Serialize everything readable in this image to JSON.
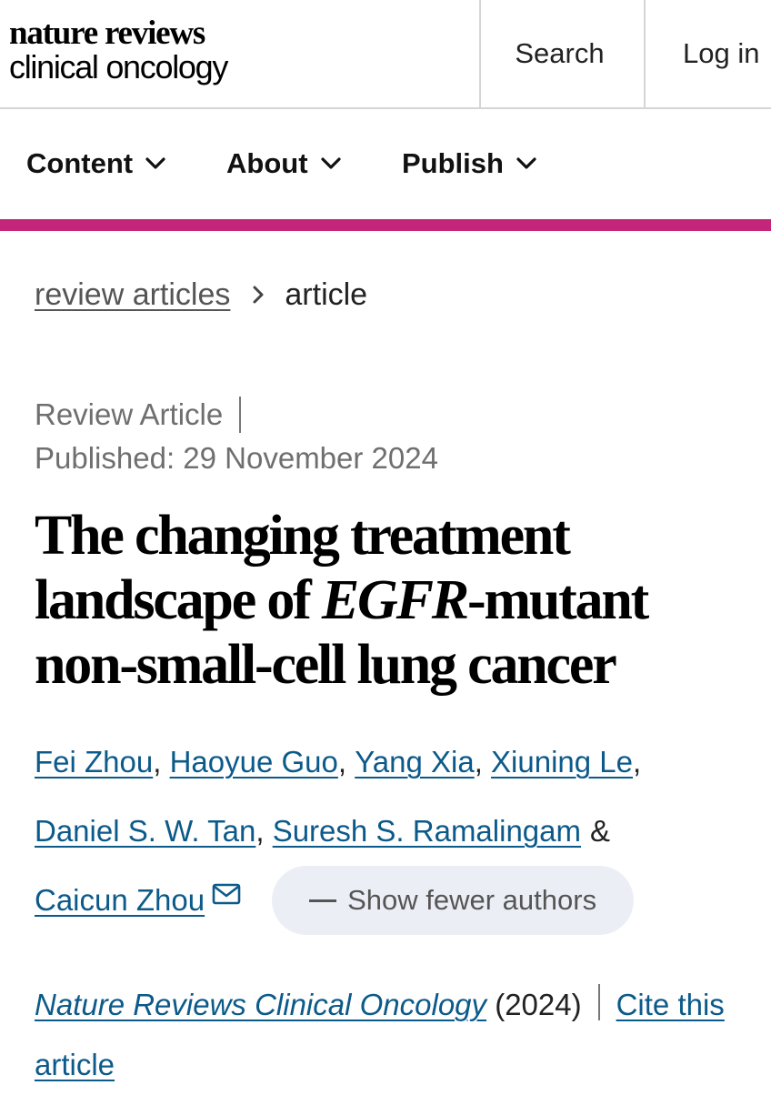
{
  "header": {
    "logo_top": "nature reviews",
    "logo_bottom": "clinical oncology",
    "search_label": "Search",
    "login_label": "Log in"
  },
  "nav": {
    "items": [
      {
        "label": "Content",
        "icon": "chevron-down-icon"
      },
      {
        "label": "About",
        "icon": "chevron-down-icon"
      },
      {
        "label": "Publish",
        "icon": "chevron-down-icon"
      }
    ],
    "accent_color": "#c3257a"
  },
  "breadcrumb": {
    "parent": "review articles",
    "separator_icon": "chevron-right-icon",
    "current": "article"
  },
  "article": {
    "type": "Review Article",
    "published": "Published: 29 November 2024",
    "title": {
      "line1": "The changing treatment",
      "line2_pre": "landscape of ",
      "line2_em": "EGFR",
      "line2_post": "-mutant",
      "line3": "non-small-cell lung cancer"
    },
    "authors": [
      "Fei Zhou",
      "Haoyue Guo",
      "Yang Xia",
      "Xiuning Le",
      "Daniel S. W. Tan",
      "Suresh S. Ramalingam",
      "Caicun Zhou"
    ],
    "author_separator": ",",
    "author_conjunction": "&",
    "corresponding_icon": "mail-icon",
    "show_fewer_label": "Show fewer authors",
    "journal": "Nature Reviews Clinical Oncology",
    "year": "(2024)",
    "cite_label": "Cite this article"
  },
  "colors": {
    "link": "#0c5a8a",
    "muted_text": "#6f6f6f",
    "pill_background": "#ebeff5"
  }
}
